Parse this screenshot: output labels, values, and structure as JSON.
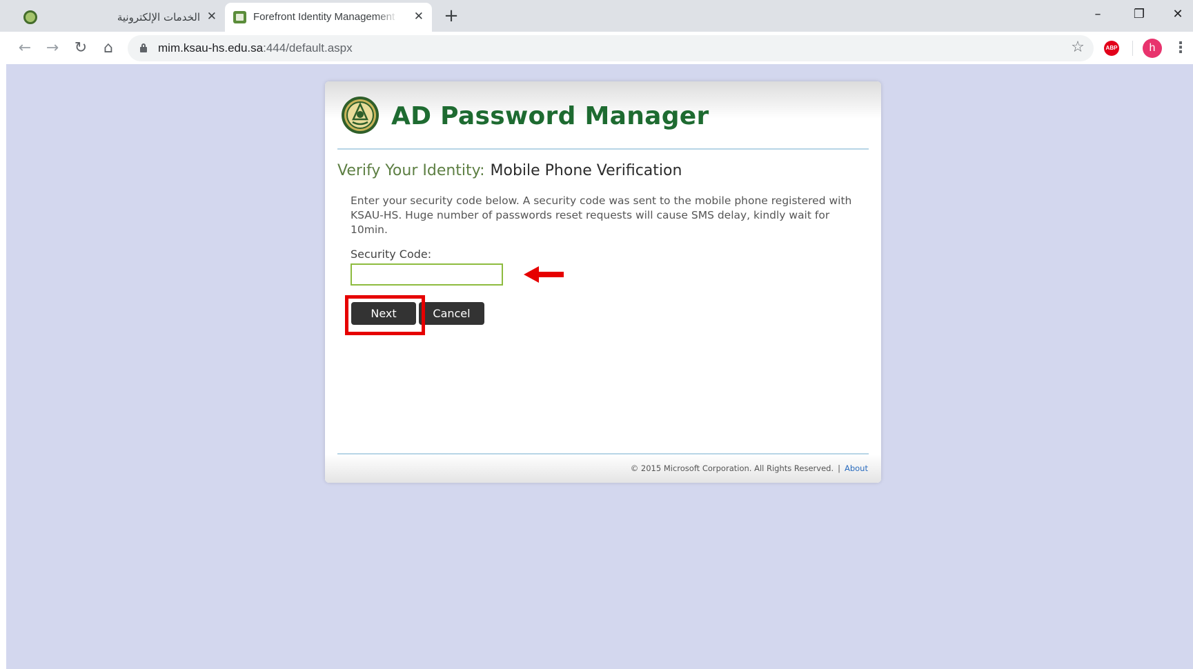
{
  "browser": {
    "tabs": [
      {
        "title": "الخدمات الإلكترونية",
        "active": false
      },
      {
        "title": "Forefront Identity Management",
        "active": true
      }
    ],
    "new_tab_icon": "+",
    "close_icon": "✕",
    "window_controls": {
      "minimize": "–",
      "restore": "❐",
      "close": "✕"
    },
    "nav_icons": {
      "back": "←",
      "forward": "→",
      "reload": "↻",
      "home": "⌂"
    },
    "url_host": "mim.ksau-hs.edu.sa",
    "url_rest": ":444/default.aspx",
    "star_icon": "☆",
    "extension_label": "ABP",
    "profile_initial": "h",
    "menu_icon": "⋮"
  },
  "page": {
    "background_color": "#d3d7ee",
    "app_title": "AD Password Manager",
    "title_color": "#1e6b31",
    "verify_prefix": "Verify Your Identity:",
    "verify_method": "Mobile Phone Verification",
    "instructions": "Enter your security code below. A security code was sent to the mobile phone registered with KSAU-HS. Huge number of passwords reset requests will cause SMS delay, kindly wait for 10min.",
    "security_code_label": "Security Code:",
    "security_code_value": "",
    "next_label": "Next",
    "cancel_label": "Cancel",
    "copyright": "© 2015 Microsoft Corporation. All Rights Reserved.",
    "footer_separator": "|",
    "about_label": "About",
    "annotation_color": "#e60000"
  }
}
